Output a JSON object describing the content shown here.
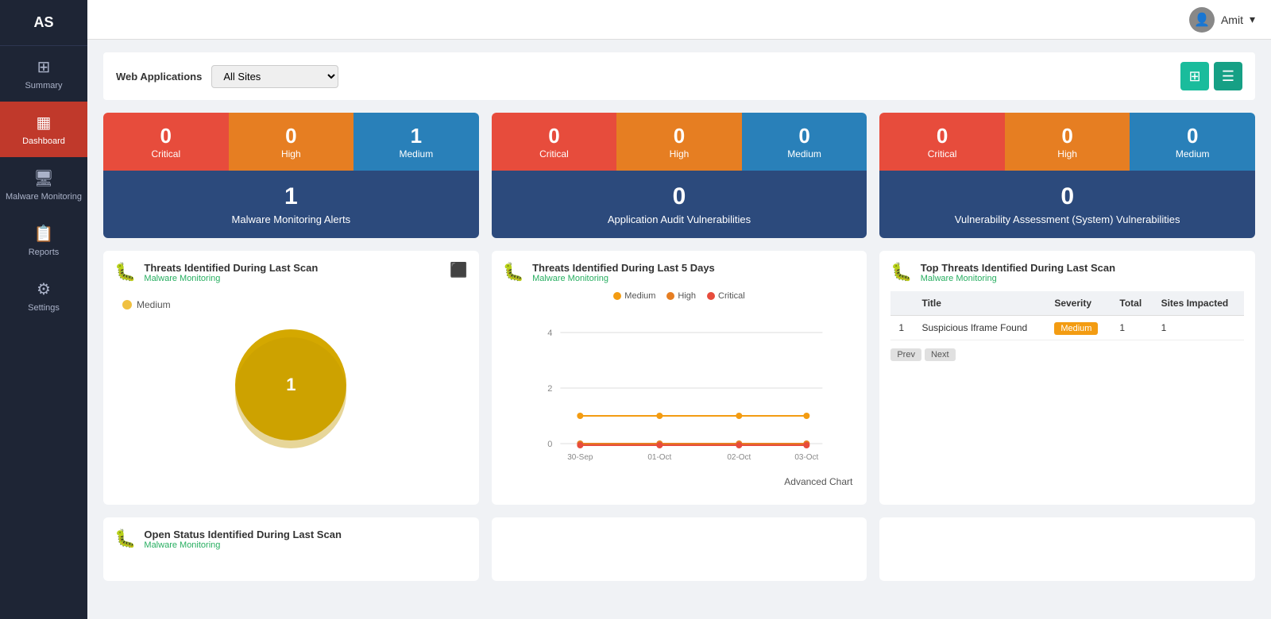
{
  "sidebar": {
    "logo": "AS",
    "items": [
      {
        "id": "summary",
        "label": "Summary",
        "icon": "⊞",
        "active": false
      },
      {
        "id": "dashboard",
        "label": "Dashboard",
        "icon": "▦",
        "active": true
      },
      {
        "id": "malware-monitoring",
        "label": "Malware Monitoring",
        "icon": "🖥",
        "active": false
      },
      {
        "id": "reports",
        "label": "Reports",
        "icon": "📋",
        "active": false
      },
      {
        "id": "settings",
        "label": "Settings",
        "icon": "⚙",
        "active": false
      }
    ]
  },
  "topbar": {
    "username": "Amit",
    "avatar_icon": "👤"
  },
  "filter": {
    "label": "Web Applications",
    "dropdown_default": "All Sites",
    "options": [
      "All Sites"
    ]
  },
  "stat_groups": [
    {
      "id": "malware",
      "critical": {
        "value": "0",
        "label": "Critical"
      },
      "high": {
        "value": "0",
        "label": "High"
      },
      "medium": {
        "value": "1",
        "label": "Medium"
      },
      "total": "1",
      "total_label": "Malware Monitoring Alerts"
    },
    {
      "id": "app_audit",
      "critical": {
        "value": "0",
        "label": "Critical"
      },
      "high": {
        "value": "0",
        "label": "High"
      },
      "medium": {
        "value": "0",
        "label": "Medium"
      },
      "total": "0",
      "total_label": "Application Audit Vulnerabilities"
    },
    {
      "id": "vuln_assessment",
      "critical": {
        "value": "0",
        "label": "Critical"
      },
      "high": {
        "value": "0",
        "label": "High"
      },
      "medium": {
        "value": "0",
        "label": "Medium"
      },
      "total": "0",
      "total_label": "Vulnerability Assessment (System) Vulnerabilities"
    }
  ],
  "chart1": {
    "title": "Threats Identified During Last Scan",
    "subtitle": "Malware Monitoring",
    "legend": {
      "label": "Medium",
      "color": "#f0c040"
    },
    "pie_value": "1",
    "pie_color": "#d4a800"
  },
  "chart2": {
    "title": "Threats Identified During Last 5 Days",
    "subtitle": "Malware Monitoring",
    "legend": [
      {
        "label": "Medium",
        "color": "#f39c12"
      },
      {
        "label": "High",
        "color": "#e67e22"
      },
      {
        "label": "Critical",
        "color": "#e74c3c"
      }
    ],
    "x_labels": [
      "30-Sep",
      "01-Oct",
      "02-Oct",
      "03-Oct"
    ],
    "y_labels": [
      "0",
      "2",
      "4"
    ],
    "advanced_chart_label": "Advanced Chart"
  },
  "chart3": {
    "title": "Top Threats Identified During Last Scan",
    "subtitle": "Malware Monitoring",
    "table": {
      "headers": [
        "",
        "Title",
        "Severity",
        "Total",
        "Sites Impacted"
      ],
      "rows": [
        {
          "num": "1",
          "title": "Suspicious Iframe Found",
          "severity": "Medium",
          "total": "1",
          "sites": "1"
        }
      ]
    },
    "nav": {
      "prev": "Prev",
      "next": "Next"
    }
  },
  "chart4": {
    "title": "Open Status Identified During Last Scan",
    "subtitle": "Malware Monitoring"
  }
}
